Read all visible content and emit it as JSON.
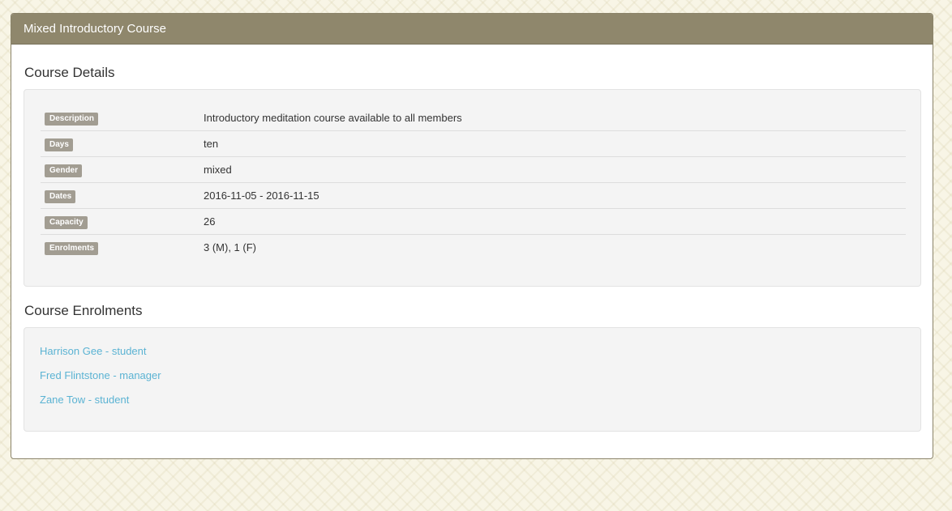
{
  "panel": {
    "title": "Mixed Introductory Course"
  },
  "details": {
    "title": "Course Details",
    "rows": [
      {
        "label": "Description",
        "value": "Introductory meditation course available to all members"
      },
      {
        "label": "Days",
        "value": "ten"
      },
      {
        "label": "Gender",
        "value": "mixed"
      },
      {
        "label": "Dates",
        "value": "2016-11-05 - 2016-11-15"
      },
      {
        "label": "Capacity",
        "value": "26"
      },
      {
        "label": "Enrolments",
        "value": "3 (M), 1 (F)"
      }
    ]
  },
  "enrolments": {
    "title": "Course Enrolments",
    "items": [
      "Harrison Gee - student",
      "Fred Flintstone - manager",
      "Zane Tow - student"
    ]
  },
  "colors": {
    "header_bg": "#8f876c",
    "label_bg": "#a29d92",
    "link": "#5bb3d3",
    "well_bg": "#f4f4f4"
  }
}
